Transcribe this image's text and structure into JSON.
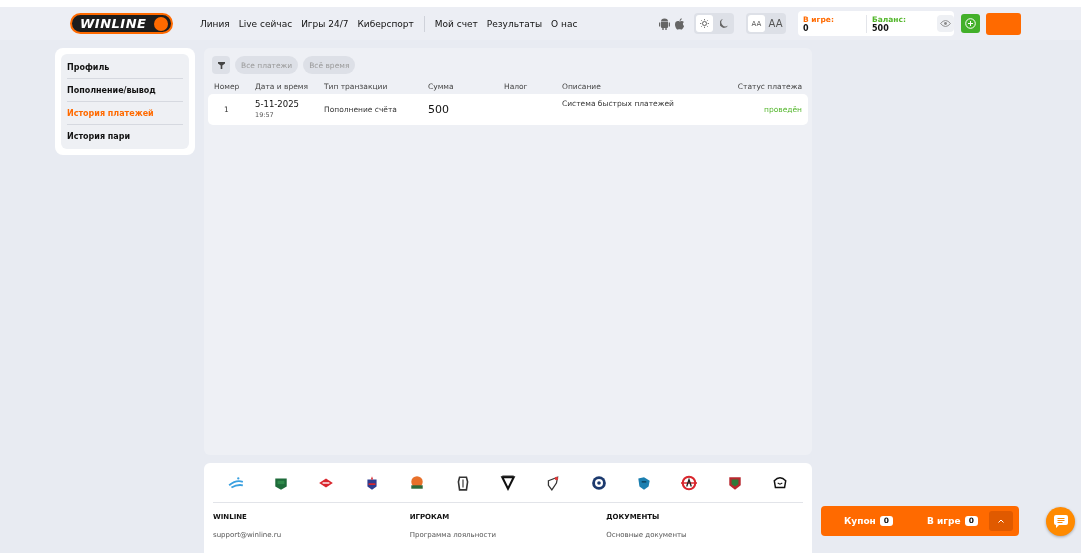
{
  "header": {
    "logo": "WINLINE",
    "nav": [
      {
        "label": "Линия"
      },
      {
        "label": "Live сейчас"
      },
      {
        "label": "Игры 24/7"
      },
      {
        "label": "Киберспорт"
      }
    ],
    "nav_secondary": [
      {
        "label": "Мой счет"
      },
      {
        "label": "Результаты"
      },
      {
        "label": "О нас"
      }
    ],
    "theme": [
      {
        "kind": "light",
        "selected": true
      },
      {
        "kind": "dark",
        "selected": false
      }
    ],
    "font_size": [
      {
        "label": "AA",
        "kind": "small",
        "selected": true
      },
      {
        "label": "AA",
        "kind": "large",
        "selected": false
      }
    ],
    "in_game": {
      "label": "В игре:",
      "value": "0"
    },
    "balance": {
      "label": "Баланс:",
      "value": "500"
    }
  },
  "sidebar": {
    "items": [
      {
        "label": "Профиль",
        "selected": false
      },
      {
        "label": "Пополнение/вывод",
        "selected": false
      },
      {
        "label": "История платежей",
        "selected": true
      },
      {
        "label": "История пари",
        "selected": false
      }
    ]
  },
  "filters": [
    {
      "label": "Все платежи"
    },
    {
      "label": "Всё время"
    }
  ],
  "table": {
    "columns": [
      "Номер",
      "Дата и время",
      "Тип транзакции",
      "Сумма",
      "Налог",
      "Описание",
      "Статус платежа"
    ],
    "rows": [
      {
        "number": "1",
        "date": "5-11-2025",
        "time": "19:57",
        "type": "Пополнение счёта",
        "amount": "500",
        "description": "Система быстрых платежей",
        "status": "проведён"
      }
    ]
  },
  "footer": {
    "columns": [
      {
        "title": "WINLINE",
        "link": "support@winline.ru"
      },
      {
        "title": "ИГРОКАМ",
        "link": "Программа лояльности"
      },
      {
        "title": "ДОКУМЕНТЫ",
        "link": "Основные документы"
      }
    ]
  },
  "coupon_bar": {
    "coupon": {
      "label": "Купон",
      "count": "0"
    },
    "in_game": {
      "label": "В игре",
      "count": "0"
    }
  }
}
